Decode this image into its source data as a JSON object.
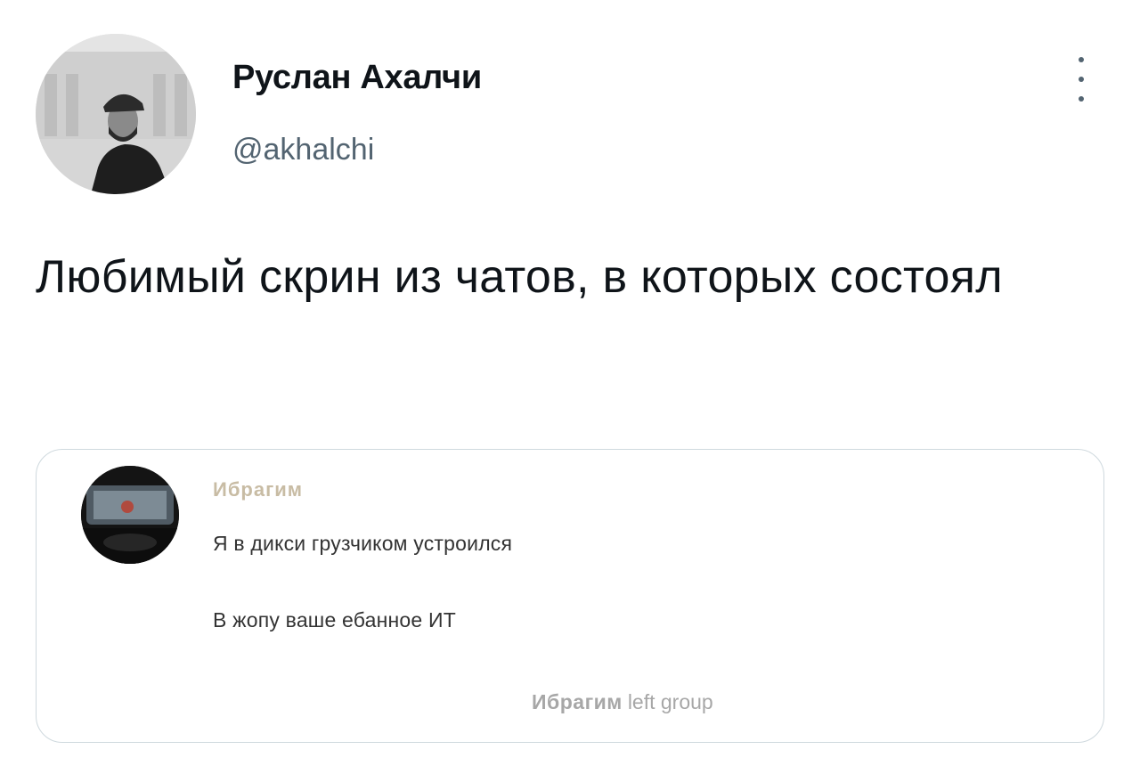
{
  "tweet": {
    "author": {
      "display_name": "Руслан Ахалчи",
      "handle": "@akhalchi"
    },
    "more_icon": "more-vertical-icon",
    "text": "Любимый скрин из чатов, в которых состоял"
  },
  "media": {
    "chat": {
      "sender": "Ибрагим",
      "messages": [
        "Я в дикси грузчиком устроился",
        "В жопу ваше ебанное ИТ"
      ],
      "service_message": {
        "name": "Ибрагим",
        "action": "left group"
      }
    }
  },
  "colors": {
    "text_primary": "#0f1419",
    "text_secondary": "#536471",
    "card_border": "#cfd9de",
    "chat_sender": "#c8bca4",
    "service_text": "#a7a7a7"
  }
}
